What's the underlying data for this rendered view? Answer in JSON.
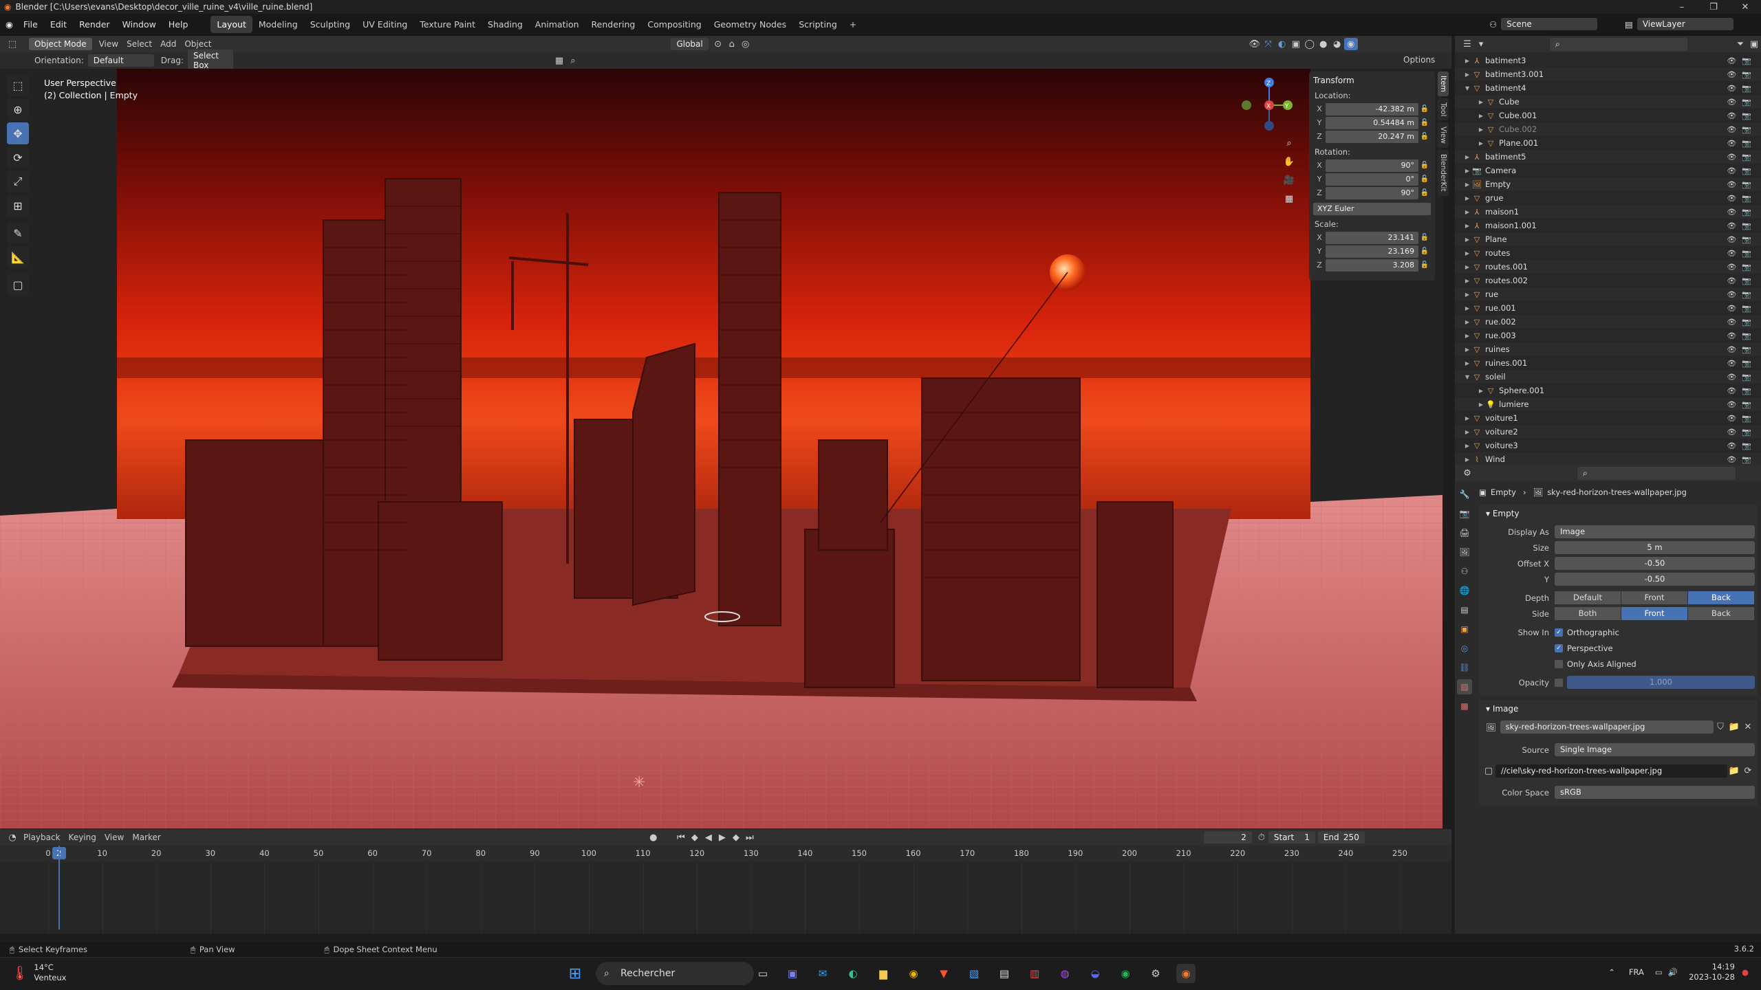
{
  "window": {
    "title": "Blender [C:\\Users\\evans\\Desktop\\decor_ville_ruine_v4\\ville_ruine.blend]",
    "controls": [
      "–",
      "❐",
      "✕"
    ]
  },
  "menu": [
    "File",
    "Edit",
    "Render",
    "Window",
    "Help"
  ],
  "workspaces": [
    "Layout",
    "Modeling",
    "Sculpting",
    "UV Editing",
    "Texture Paint",
    "Shading",
    "Animation",
    "Rendering",
    "Compositing",
    "Geometry Nodes",
    "Scripting"
  ],
  "scene": {
    "label": "Scene",
    "view_layer": "ViewLayer"
  },
  "viewport_header": {
    "mode": "Object Mode",
    "menus": [
      "View",
      "Select",
      "Add",
      "Object"
    ],
    "transform_space": "Global",
    "orientation_label": "Orientation:",
    "orientation": "Default",
    "drag_label": "Drag:",
    "drag": "Select Box",
    "options": "Options"
  },
  "viewport": {
    "perspective": "User Perspective",
    "collection": "(2) Collection | Empty"
  },
  "npanel": {
    "title": "Transform",
    "location_label": "Location:",
    "location": [
      "-42.382 m",
      "0.54484 m",
      "20.247 m"
    ],
    "rotation_label": "Rotation:",
    "rotation": [
      "90°",
      "0°",
      "90°"
    ],
    "rotation_mode": "XYZ Euler",
    "scale_label": "Scale:",
    "scale": [
      "23.141",
      "23.169",
      "3.208"
    ],
    "axes": [
      "X",
      "Y",
      "Z"
    ],
    "tabs": [
      "Item",
      "Tool",
      "View",
      "BlenderKit"
    ]
  },
  "outliner": {
    "items": [
      {
        "name": "batiment3",
        "indent": 0,
        "icon": "empty"
      },
      {
        "name": "batiment3.001",
        "indent": 0,
        "icon": "mesh"
      },
      {
        "name": "batiment4",
        "indent": 0,
        "icon": "mesh",
        "open": true
      },
      {
        "name": "Cube",
        "indent": 1,
        "icon": "mesh"
      },
      {
        "name": "Cube.001",
        "indent": 1,
        "icon": "mesh"
      },
      {
        "name": "Cube.002",
        "indent": 1,
        "icon": "mesh",
        "dim": true
      },
      {
        "name": "Plane.001",
        "indent": 1,
        "icon": "mesh"
      },
      {
        "name": "batiment5",
        "indent": 0,
        "icon": "empty"
      },
      {
        "name": "Camera",
        "indent": 0,
        "icon": "camera"
      },
      {
        "name": "Empty",
        "indent": 0,
        "icon": "image"
      },
      {
        "name": "grue",
        "indent": 0,
        "icon": "mesh"
      },
      {
        "name": "maison1",
        "indent": 0,
        "icon": "empty"
      },
      {
        "name": "maison1.001",
        "indent": 0,
        "icon": "empty"
      },
      {
        "name": "Plane",
        "indent": 0,
        "icon": "mesh"
      },
      {
        "name": "routes",
        "indent": 0,
        "icon": "mesh"
      },
      {
        "name": "routes.001",
        "indent": 0,
        "icon": "mesh"
      },
      {
        "name": "routes.002",
        "indent": 0,
        "icon": "mesh"
      },
      {
        "name": "rue",
        "indent": 0,
        "icon": "mesh"
      },
      {
        "name": "rue.001",
        "indent": 0,
        "icon": "mesh"
      },
      {
        "name": "rue.002",
        "indent": 0,
        "icon": "mesh"
      },
      {
        "name": "rue.003",
        "indent": 0,
        "icon": "mesh"
      },
      {
        "name": "ruines",
        "indent": 0,
        "icon": "mesh"
      },
      {
        "name": "ruines.001",
        "indent": 0,
        "icon": "mesh"
      },
      {
        "name": "soleil",
        "indent": 0,
        "icon": "mesh",
        "open": true
      },
      {
        "name": "Sphere.001",
        "indent": 1,
        "icon": "mesh"
      },
      {
        "name": "lumiere",
        "indent": 1,
        "icon": "light"
      },
      {
        "name": "voiture1",
        "indent": 0,
        "icon": "mesh"
      },
      {
        "name": "voiture2",
        "indent": 0,
        "icon": "mesh"
      },
      {
        "name": "voiture3",
        "indent": 0,
        "icon": "mesh"
      },
      {
        "name": "Wind",
        "indent": 0,
        "icon": "force"
      }
    ]
  },
  "properties": {
    "breadcrumb": [
      "Empty",
      "sky-red-horizon-trees-wallpaper.jpg"
    ],
    "empty_section": "Empty",
    "display_as_label": "Display As",
    "display_as": "Image",
    "size_label": "Size",
    "size": "5 m",
    "offset_x_label": "Offset X",
    "offset_x": "-0.50",
    "offset_y_label": "Y",
    "offset_y": "-0.50",
    "depth_label": "Depth",
    "depth_options": [
      "Default",
      "Front",
      "Back"
    ],
    "side_label": "Side",
    "side_options": [
      "Both",
      "Front",
      "Back"
    ],
    "show_in_label": "Show In",
    "show_in": [
      "Orthographic",
      "Perspective",
      "Only Axis Aligned"
    ],
    "opacity_label": "Opacity",
    "opacity": "1.000",
    "image_section": "Image",
    "image_name": "sky-red-horizon-trees-wallpaper.jpg",
    "source_label": "Source",
    "source": "Single Image",
    "filepath": "//ciel\\sky-red-horizon-trees-wallpaper.jpg",
    "color_space_label": "Color Space",
    "color_space": "sRGB"
  },
  "timeline": {
    "menus": [
      "Playback",
      "Keying",
      "View",
      "Marker"
    ],
    "current_frame": "2",
    "start_label": "Start",
    "start": "1",
    "end_label": "End",
    "end": "250",
    "ticks": [
      "0",
      "10",
      "20",
      "30",
      "40",
      "50",
      "60",
      "70",
      "80",
      "90",
      "100",
      "110",
      "120",
      "130",
      "140",
      "150",
      "160",
      "170",
      "180",
      "190",
      "200",
      "210",
      "220",
      "230",
      "240",
      "250"
    ]
  },
  "status": {
    "left": "Select Keyframes",
    "middle": "Pan View",
    "right": "Dope Sheet Context Menu",
    "version": "3.6.2"
  },
  "taskbar": {
    "weather_temp": "14°C",
    "weather_desc": "Venteux",
    "search": "Rechercher",
    "lang": "FRA",
    "time": "14:19",
    "date": "2023-10-28"
  }
}
